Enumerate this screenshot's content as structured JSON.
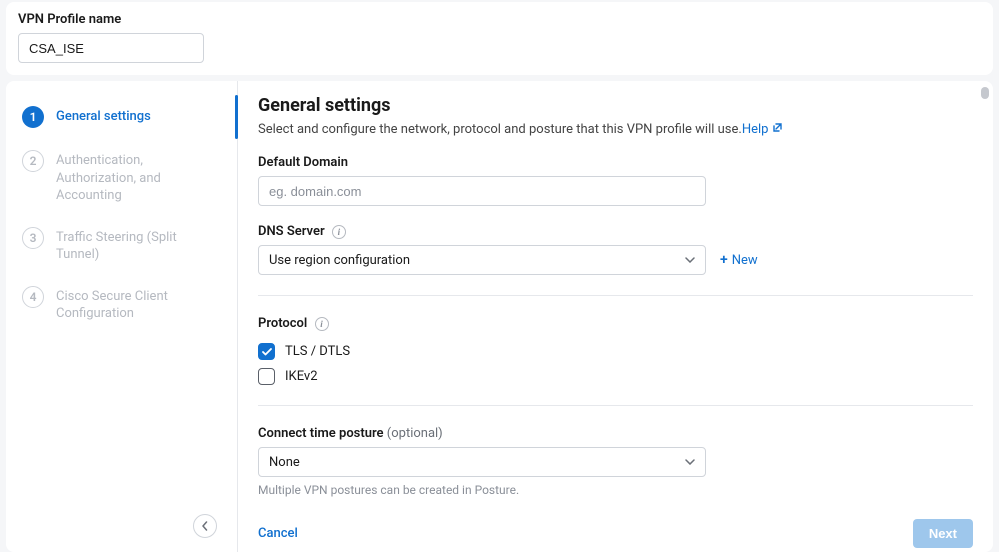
{
  "profile": {
    "label": "VPN Profile name",
    "value": "CSA_ISE"
  },
  "steps": [
    {
      "num": "1",
      "label": "General settings"
    },
    {
      "num": "2",
      "label": "Authentication, Authorization, and Accounting"
    },
    {
      "num": "3",
      "label": "Traffic Steering (Split Tunnel)"
    },
    {
      "num": "4",
      "label": "Cisco Secure Client Configuration"
    }
  ],
  "general": {
    "title": "General settings",
    "desc": "Select and configure the network, protocol and posture that this VPN profile will use.",
    "help": "Help"
  },
  "domain": {
    "label": "Default Domain",
    "placeholder": "eg. domain.com",
    "value": ""
  },
  "dns": {
    "label": "DNS Server",
    "selected": "Use region configuration",
    "new_label": "New"
  },
  "protocol": {
    "label": "Protocol",
    "options": [
      {
        "label": "TLS / DTLS",
        "checked": true
      },
      {
        "label": "IKEv2",
        "checked": false
      }
    ]
  },
  "posture": {
    "label": "Connect time posture",
    "optional": "(optional)",
    "selected": "None",
    "helper": "Multiple VPN postures can be created in Posture."
  },
  "footer": {
    "cancel": "Cancel",
    "next": "Next"
  }
}
